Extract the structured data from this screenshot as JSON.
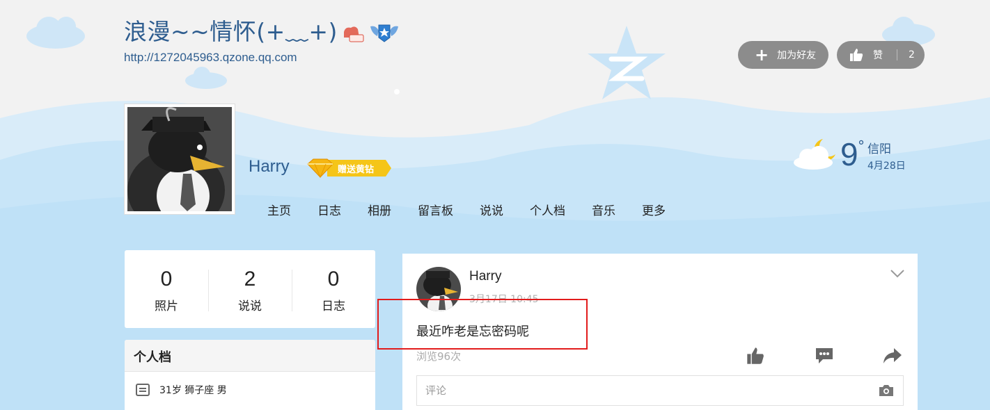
{
  "header": {
    "title": "浪漫~~情怀(+﹏+)",
    "url": "http://1272045963.qzone.qq.com",
    "add_friend_label": "加为好友",
    "like_label": "赞",
    "like_count": "2"
  },
  "profile_head": {
    "username": "Harry",
    "vip_label": "赠送黄钻"
  },
  "nav": [
    "主页",
    "日志",
    "相册",
    "留言板",
    "说说",
    "个人档",
    "音乐",
    "更多"
  ],
  "weather": {
    "temp": "9",
    "degree": "°",
    "city": "信阳",
    "date": "4月28日"
  },
  "stats": [
    {
      "value": "0",
      "label": "照片"
    },
    {
      "value": "2",
      "label": "说说"
    },
    {
      "value": "0",
      "label": "日志"
    }
  ],
  "profile_card": {
    "title": "个人档",
    "info": "31岁  狮子座 男"
  },
  "feed": {
    "author": "Harry",
    "time": "3月17日 10:45",
    "text": "最近咋老是忘密码呢",
    "views": "浏览96次",
    "comment_placeholder": "评论"
  },
  "colors": {
    "title_blue": "#2e5d8f",
    "pill_gray": "#8c8c8c",
    "highlight_red": "#e21b1b",
    "sky_blue": "#bfe1f7"
  },
  "icons": [
    "plus-icon",
    "thumbs-up-icon",
    "cloud-moon-icon",
    "profile-card-icon",
    "chevron-down-icon",
    "comment-icon",
    "share-icon",
    "camera-icon"
  ]
}
